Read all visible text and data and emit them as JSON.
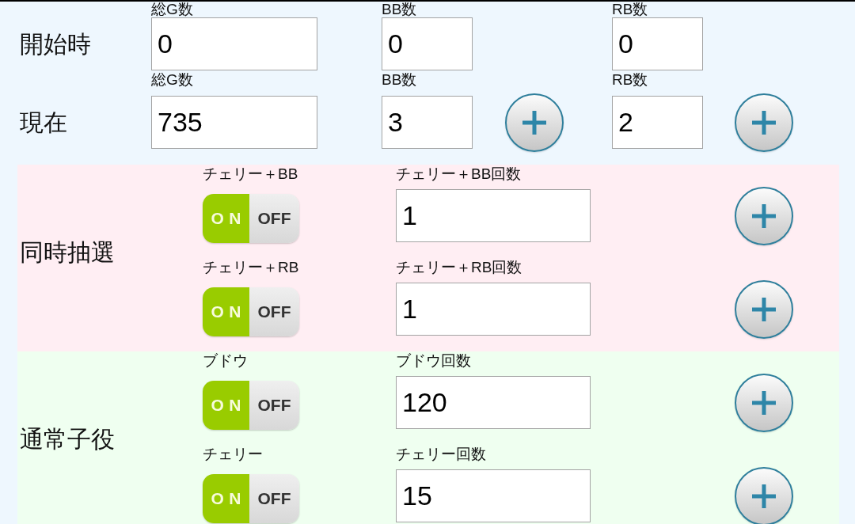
{
  "rows": [
    {
      "label": "開始時",
      "fields": [
        {
          "label": "総G数",
          "value": "0"
        },
        {
          "label": "BB数",
          "value": "0",
          "plus_button": false
        },
        {
          "label": "RB数",
          "value": "0",
          "plus_button": false
        }
      ]
    },
    {
      "label": "現在",
      "fields": [
        {
          "label": "総G数",
          "value": "735"
        },
        {
          "label": "BB数",
          "value": "3",
          "plus_button": true
        },
        {
          "label": "RB数",
          "value": "2",
          "plus_button": true
        }
      ]
    }
  ],
  "sections": [
    {
      "title": "同時抽選",
      "color": "#ffeef3",
      "items": [
        {
          "label": "チェリー＋BB",
          "toggle": {
            "on": true,
            "on_text": "ON",
            "off_text": "OFF"
          },
          "count_label": "チェリー＋BB回数",
          "count": "1"
        },
        {
          "label": "チェリー＋RB",
          "toggle": {
            "on": true,
            "on_text": "ON",
            "off_text": "OFF"
          },
          "count_label": "チェリー＋RB回数",
          "count": "1"
        }
      ]
    },
    {
      "title": "通常子役",
      "color": "#effff0",
      "items": [
        {
          "label": "ブドウ",
          "toggle": {
            "on": true,
            "on_text": "ON",
            "off_text": "OFF"
          },
          "count_label": "ブドウ回数",
          "count": "120"
        },
        {
          "label": "チェリー",
          "toggle": {
            "on": true,
            "on_text": "ON",
            "off_text": "OFF"
          },
          "count_label": "チェリー回数",
          "count": "15"
        }
      ]
    }
  ]
}
